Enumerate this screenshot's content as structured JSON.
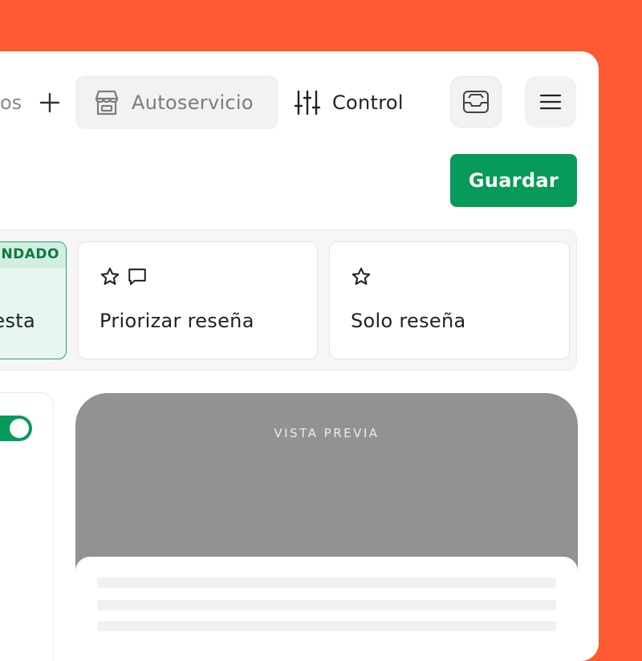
{
  "nav": {
    "prev_tab_partial": "os",
    "tabs": [
      {
        "label": "Autoservicio",
        "icon": "store-icon",
        "state": "inactive"
      },
      {
        "label": "Control",
        "icon": "sliders-icon",
        "state": "active"
      }
    ],
    "tray_icon": "tray-icon",
    "menu_icon": "hamburger-menu-icon"
  },
  "toolbar": {
    "save_label": "Guardar"
  },
  "options": {
    "cards": [
      {
        "badge": "ENDADO",
        "label": "esta",
        "state": "selected"
      },
      {
        "label": "Priorizar reseña",
        "icons": [
          "star-icon",
          "chat-bubble-icon"
        ]
      },
      {
        "label": "Solo reseña",
        "icons": [
          "star-icon"
        ]
      }
    ]
  },
  "settings": {
    "toggle_on": true
  },
  "preview": {
    "label": "VISTA PREVIA"
  },
  "colors": {
    "background": "#FF5A31",
    "accent_green": "#079A5A",
    "selected_card_bg": "#E7F6EE",
    "preview_gray": "#929292"
  }
}
